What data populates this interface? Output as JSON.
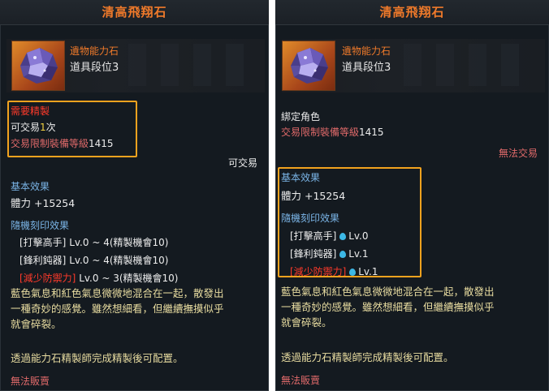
{
  "left": {
    "title": "清高飛翔石",
    "item_type": "遺物能力石",
    "item_grade": "道具段位3",
    "refine_required": "需要精製",
    "tradable_prefix": "可交易",
    "tradable_count": "1",
    "tradable_suffix": "次",
    "trade_limit_label": "交易限制裝備等級",
    "trade_limit_value": "1415",
    "trade_status": "可交易",
    "basic_effect_label": "基本效果",
    "basic_effect_value": "體力 +15254",
    "random_effect_label": "隨機刻印效果",
    "engravings": [
      {
        "name": "[打擊高手]",
        "color": "#ececec",
        "level": "Lv.0 ~ 4(精製機會10)"
      },
      {
        "name": "[鋒利鈍器]",
        "color": "#ececec",
        "level": "Lv.0 ~ 4(精製機會10)"
      },
      {
        "name": "[減少防禦力]",
        "color": "#ff3a2a",
        "level": "Lv.0 ~ 3(精製機會10)",
        "bracket_split": true
      }
    ],
    "description_1": "藍色氣息和紅色氣息微微地混合在一起，散發出",
    "description_2": "一種奇妙的感覺。雖然想細看，但繼續撫摸似乎",
    "description_3": "就會碎裂。",
    "note": "透過能力石精製師完成精製後可配置。",
    "sell_status": "無法販賣"
  },
  "right": {
    "title": "清高飛翔石",
    "item_type": "遺物能力石",
    "item_grade": "道具段位3",
    "bound": "綁定角色",
    "trade_limit_label": "交易限制裝備等級",
    "trade_limit_value": "1415",
    "trade_status": "無法交易",
    "basic_effect_label": "基本效果",
    "basic_effect_value": "體力 +15254",
    "random_effect_label": "隨機刻印效果",
    "engravings": [
      {
        "name": "[打擊高手]",
        "level": "Lv.0"
      },
      {
        "name": "[鋒利鈍器]",
        "level": "Lv.1"
      },
      {
        "name": "[減少防禦力]",
        "level": "Lv.1"
      }
    ],
    "description_1": "藍色氣息和紅色氣息微微地混合在一起，散發出",
    "description_2": "一種奇妙的感覺。雖然想細看，但繼續撫摸似乎",
    "description_3": "就會碎裂。",
    "note": "透過能力石精製師完成精製後可配置。",
    "sell_status": "無法販賣"
  },
  "colors": {
    "title": "#f07a2a",
    "highlight_box": "#f2a21e",
    "warning_red": "#ff3a2a",
    "trade_pink": "#e06a6a",
    "section_blue": "#7ab4e6",
    "description_gold": "#e8dca0"
  },
  "icons": [
    "ability-stone-icon",
    "water-drop-icon"
  ]
}
